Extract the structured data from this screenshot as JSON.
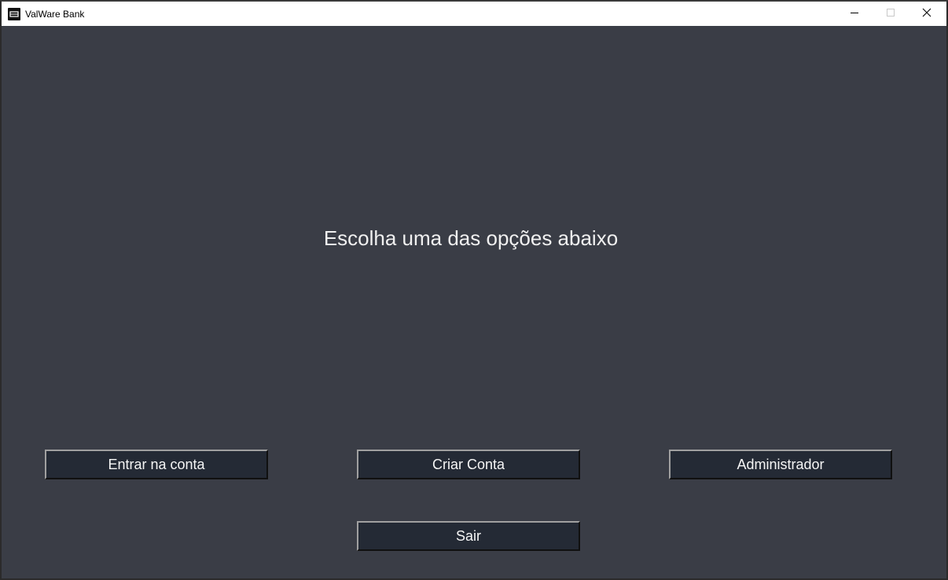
{
  "window": {
    "title": "ValWare Bank",
    "icon": "bank-app-icon",
    "controls": {
      "minimize_icon": "minimize-icon",
      "maximize_icon": "maximize-icon",
      "close_icon": "close-icon"
    }
  },
  "main": {
    "heading": "Escolha uma das opções abaixo",
    "buttons": {
      "entrar": "Entrar na conta",
      "criar": "Criar Conta",
      "admin": "Administrador",
      "sair": "Sair"
    }
  },
  "colors": {
    "background": "#3a3d46",
    "button_bg": "#242a35",
    "text": "#f0f0f0",
    "titlebar": "#ffffff"
  }
}
